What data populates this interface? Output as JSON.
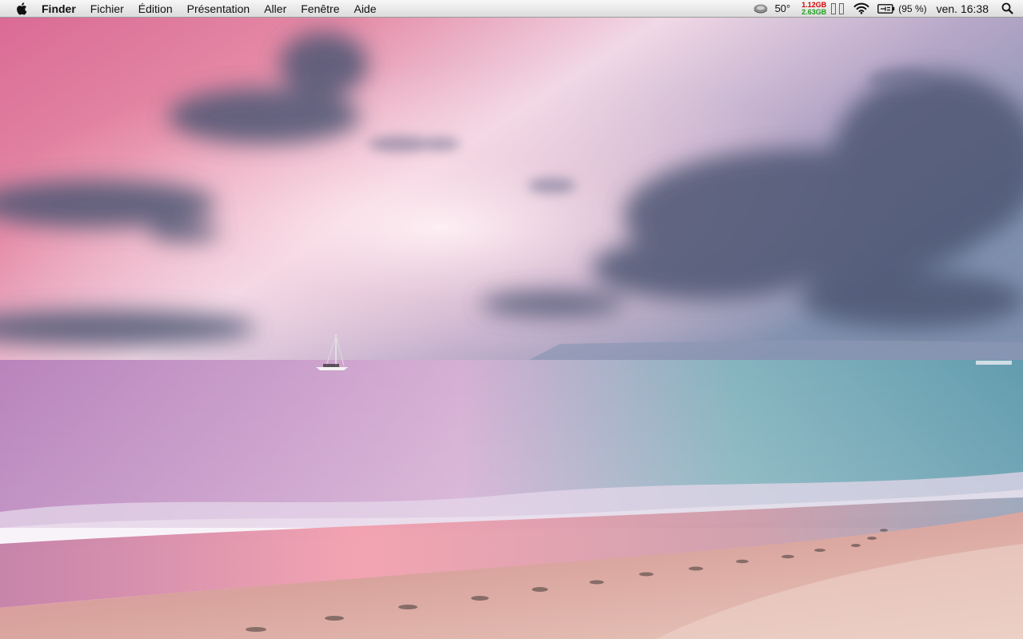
{
  "menubar": {
    "apple_icon": "apple-logo-icon",
    "app_name": "Finder",
    "menus": [
      "Fichier",
      "Édition",
      "Présentation",
      "Aller",
      "Fenêtre",
      "Aide"
    ],
    "status": {
      "temperature_icon": "cpu-temperature-icon",
      "temperature": "50°",
      "memory_used": "1.12GB",
      "memory_free": "2.63GB",
      "memory_used_color": "#d00000",
      "memory_free_color": "#1c9d1c",
      "cpu_meter_icon": "cpu-meter-icon",
      "wifi_icon": "wifi-icon",
      "battery_icon": "battery-charging-icon",
      "battery_percent": "(95 %)",
      "clock": "ven. 16:38",
      "spotlight_icon": "spotlight-search-icon"
    }
  },
  "wallpaper": {
    "subject": "sunset-beach",
    "sky_colors": [
      "#e58aa6",
      "#c49cc8",
      "#f1d8e6"
    ],
    "sea_colors": [
      "#b07ab2",
      "#6fa6b2"
    ],
    "sand_color": "#d5a7a1"
  }
}
